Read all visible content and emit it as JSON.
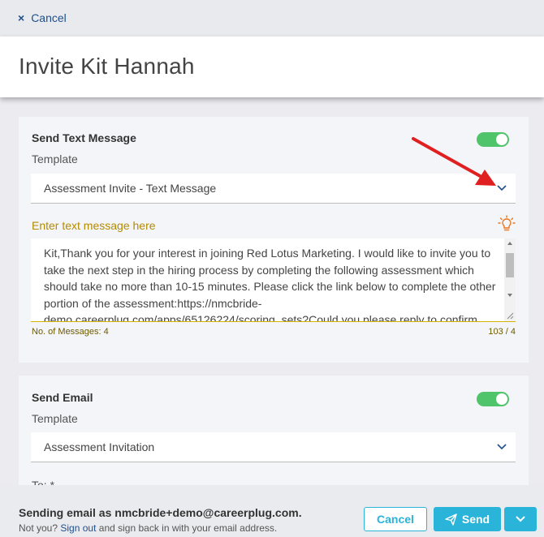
{
  "topbar": {
    "cancel_label": "Cancel",
    "close_icon": "×"
  },
  "header": {
    "title": "Invite Kit Hannah"
  },
  "sms": {
    "title": "Send Text Message",
    "template_label": "Template",
    "template_value": "Assessment Invite - Text Message",
    "enabled": true,
    "placeholder_label": "Enter text message here",
    "message": "Kit,Thank you for your interest in joining Red Lotus Marketing. I would like to invite you to take the next step in the hiring process by completing the following assessment which should take no more than 10-15 minutes. Please click the link below to complete the other portion of the assessment:https://nmcbride-demo.careerplug.com/apps/65126224/scoring_sets?Could you please reply to confirm",
    "messages_count_label": "No. of Messages: 4",
    "char_count": "103 / 4"
  },
  "email": {
    "title": "Send Email",
    "template_label": "Template",
    "template_value": "Assessment Invitation",
    "enabled": true,
    "to_label": "To: *"
  },
  "footer": {
    "sending_as": "Sending email as nmcbride+demo@careerplug.com.",
    "not_you": "Not you?",
    "sign_out": "Sign out",
    "sign_back": "and sign back in with your email address.",
    "cancel_button": "Cancel",
    "send_button": "Send"
  },
  "colors": {
    "accent": "#2ab4d9",
    "toggle_on": "#4fc46a",
    "link": "#1e4f8c",
    "sms_label": "#b38b00",
    "annotation_arrow": "#e02020"
  }
}
